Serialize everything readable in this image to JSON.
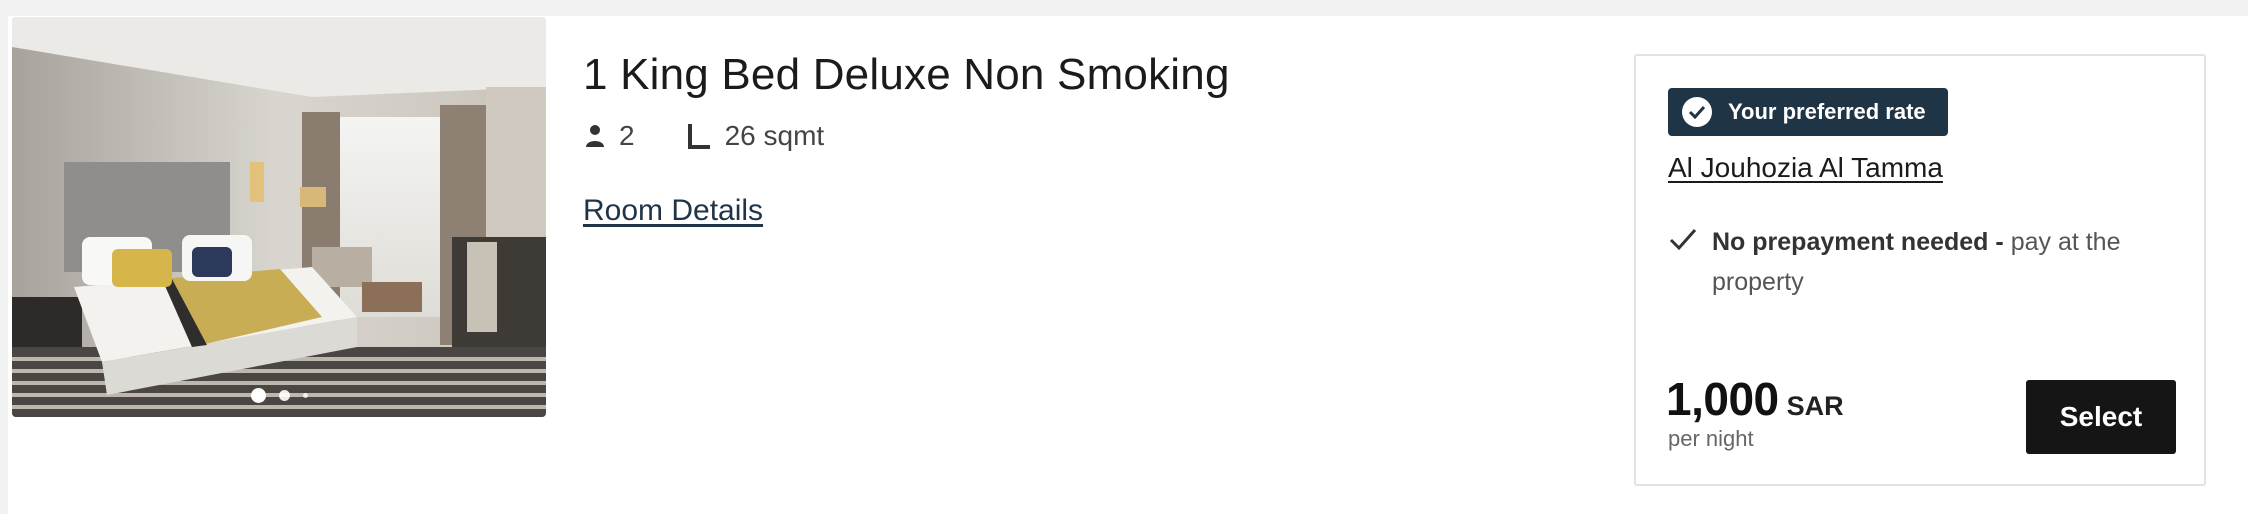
{
  "room": {
    "title": "1 King Bed Deluxe Non Smoking",
    "guests": "2",
    "size": "26 sqmt",
    "details_link": "Room Details",
    "photo_dots": 3
  },
  "rate": {
    "badge": "Your preferred rate",
    "name": "Al Jouhozia Al Tamma",
    "policy_bold": "No prepayment needed -",
    "policy_rest": "pay at the property",
    "price": "1,000",
    "currency": "SAR",
    "per_night": "per night",
    "select_label": "Select"
  },
  "colors": {
    "badge_bg": "#1f3444",
    "button_bg": "#151515",
    "link": "#1f3447"
  },
  "icons": [
    "guest-icon",
    "bed-size-icon",
    "checkmark-circle-icon",
    "check-icon"
  ]
}
